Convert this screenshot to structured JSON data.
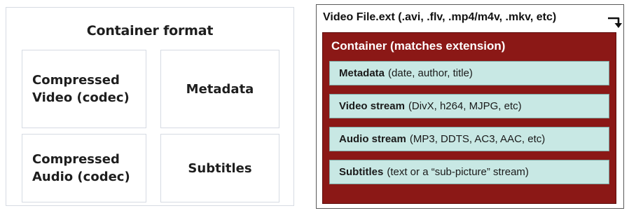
{
  "left_diagram": {
    "title": "Container format",
    "cells": [
      {
        "label": "Compressed\nVideo (codec)"
      },
      {
        "label": "Metadata"
      },
      {
        "label": "Compressed\nAudio (codec)"
      },
      {
        "label": "Subtitles"
      }
    ]
  },
  "right_diagram": {
    "file_label": "Video File.ext (.avi, .flv, .mp4/m4v, .mkv, etc)",
    "icon": "return-arrow-icon",
    "container": {
      "label": "Container (matches extension)",
      "color": "#8b1816",
      "streams": [
        {
          "name": "Metadata",
          "detail": "(date, author, title)"
        },
        {
          "name": "Video stream",
          "detail": "(DivX, h264, MJPG, etc)"
        },
        {
          "name": "Audio stream",
          "detail": "(MP3, DDTS, AC3, AAC, etc)"
        },
        {
          "name": "Subtitles",
          "detail": "(text or a “sub-picture” stream)"
        }
      ]
    },
    "stream_color": "#c8e8e4"
  }
}
